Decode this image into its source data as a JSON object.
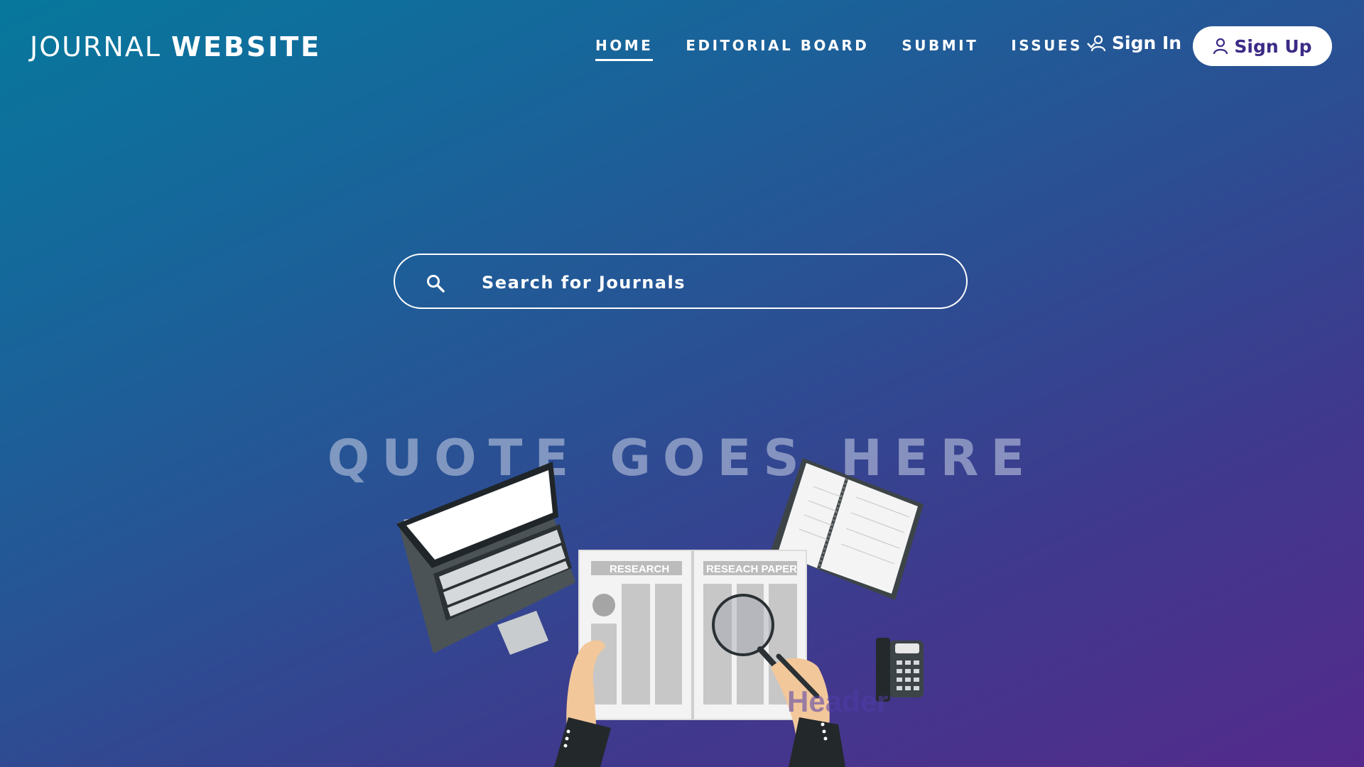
{
  "header": {
    "logo_light": "JOURNAL",
    "logo_bold": "WEBSITE",
    "nav": [
      {
        "label": "HOME",
        "active": true
      },
      {
        "label": "EDITORIAL BOARD",
        "active": false
      },
      {
        "label": "SUBMIT",
        "active": false
      },
      {
        "label": "ISSUES",
        "active": false,
        "has_dropdown": true
      }
    ],
    "sign_in": "Sign In",
    "sign_up": "Sign Up"
  },
  "search": {
    "placeholder": "Search for Journals",
    "icon": "search-icon"
  },
  "hero": {
    "quote": "QUOTE GOES HERE"
  },
  "illustration": {
    "paper_left_title": "RESEARCH",
    "paper_right_title": "RESEACH PAPER",
    "overlay_text": "Header"
  },
  "colors": {
    "gradient_start": "#07789c",
    "gradient_end": "#542a8c",
    "signup_text": "#3c2a86"
  }
}
